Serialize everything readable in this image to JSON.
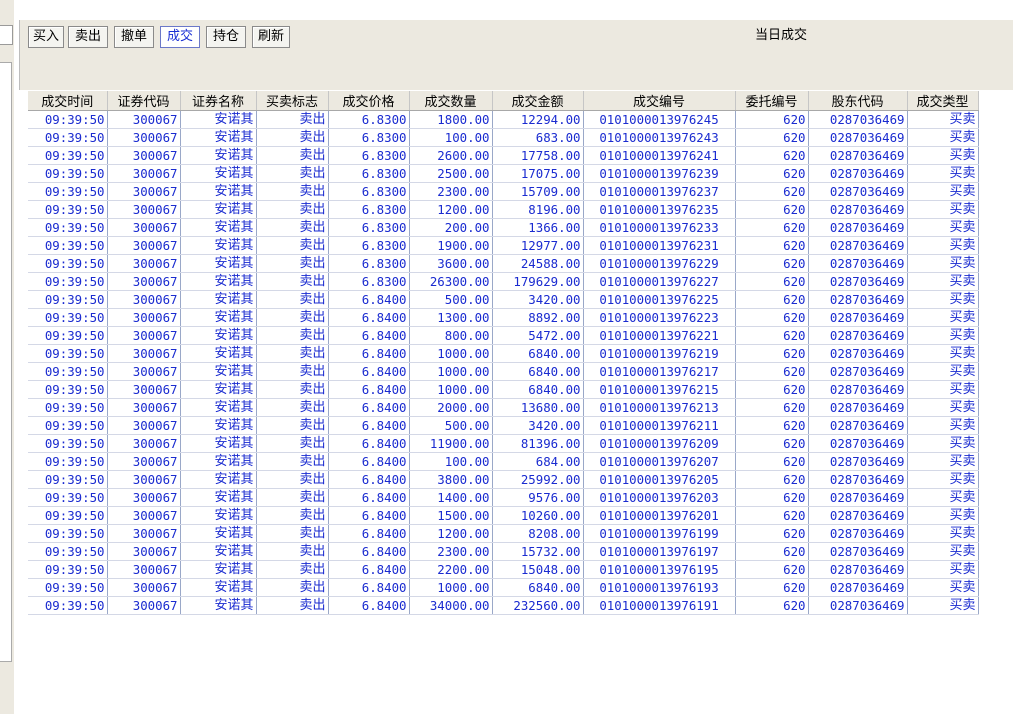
{
  "toolbar": {
    "buttons": [
      "买入",
      "卖出",
      "撤单",
      "成交",
      "持仓",
      "刷新"
    ],
    "active": "成交",
    "title": "当日成交"
  },
  "table": {
    "columns": [
      "成交时间",
      "证券代码",
      "证券名称",
      "买卖标志",
      "成交价格",
      "成交数量",
      "成交金额",
      "成交编号",
      "委托编号",
      "股东代码",
      "成交类型"
    ],
    "rows": [
      [
        "09:39:50",
        "300067",
        "安诺其",
        "卖出",
        "6.8300",
        "1800.00",
        "12294.00",
        "0101000013976245",
        "620",
        "0287036469",
        "买卖"
      ],
      [
        "09:39:50",
        "300067",
        "安诺其",
        "卖出",
        "6.8300",
        "100.00",
        "683.00",
        "0101000013976243",
        "620",
        "0287036469",
        "买卖"
      ],
      [
        "09:39:50",
        "300067",
        "安诺其",
        "卖出",
        "6.8300",
        "2600.00",
        "17758.00",
        "0101000013976241",
        "620",
        "0287036469",
        "买卖"
      ],
      [
        "09:39:50",
        "300067",
        "安诺其",
        "卖出",
        "6.8300",
        "2500.00",
        "17075.00",
        "0101000013976239",
        "620",
        "0287036469",
        "买卖"
      ],
      [
        "09:39:50",
        "300067",
        "安诺其",
        "卖出",
        "6.8300",
        "2300.00",
        "15709.00",
        "0101000013976237",
        "620",
        "0287036469",
        "买卖"
      ],
      [
        "09:39:50",
        "300067",
        "安诺其",
        "卖出",
        "6.8300",
        "1200.00",
        "8196.00",
        "0101000013976235",
        "620",
        "0287036469",
        "买卖"
      ],
      [
        "09:39:50",
        "300067",
        "安诺其",
        "卖出",
        "6.8300",
        "200.00",
        "1366.00",
        "0101000013976233",
        "620",
        "0287036469",
        "买卖"
      ],
      [
        "09:39:50",
        "300067",
        "安诺其",
        "卖出",
        "6.8300",
        "1900.00",
        "12977.00",
        "0101000013976231",
        "620",
        "0287036469",
        "买卖"
      ],
      [
        "09:39:50",
        "300067",
        "安诺其",
        "卖出",
        "6.8300",
        "3600.00",
        "24588.00",
        "0101000013976229",
        "620",
        "0287036469",
        "买卖"
      ],
      [
        "09:39:50",
        "300067",
        "安诺其",
        "卖出",
        "6.8300",
        "26300.00",
        "179629.00",
        "0101000013976227",
        "620",
        "0287036469",
        "买卖"
      ],
      [
        "09:39:50",
        "300067",
        "安诺其",
        "卖出",
        "6.8400",
        "500.00",
        "3420.00",
        "0101000013976225",
        "620",
        "0287036469",
        "买卖"
      ],
      [
        "09:39:50",
        "300067",
        "安诺其",
        "卖出",
        "6.8400",
        "1300.00",
        "8892.00",
        "0101000013976223",
        "620",
        "0287036469",
        "买卖"
      ],
      [
        "09:39:50",
        "300067",
        "安诺其",
        "卖出",
        "6.8400",
        "800.00",
        "5472.00",
        "0101000013976221",
        "620",
        "0287036469",
        "买卖"
      ],
      [
        "09:39:50",
        "300067",
        "安诺其",
        "卖出",
        "6.8400",
        "1000.00",
        "6840.00",
        "0101000013976219",
        "620",
        "0287036469",
        "买卖"
      ],
      [
        "09:39:50",
        "300067",
        "安诺其",
        "卖出",
        "6.8400",
        "1000.00",
        "6840.00",
        "0101000013976217",
        "620",
        "0287036469",
        "买卖"
      ],
      [
        "09:39:50",
        "300067",
        "安诺其",
        "卖出",
        "6.8400",
        "1000.00",
        "6840.00",
        "0101000013976215",
        "620",
        "0287036469",
        "买卖"
      ],
      [
        "09:39:50",
        "300067",
        "安诺其",
        "卖出",
        "6.8400",
        "2000.00",
        "13680.00",
        "0101000013976213",
        "620",
        "0287036469",
        "买卖"
      ],
      [
        "09:39:50",
        "300067",
        "安诺其",
        "卖出",
        "6.8400",
        "500.00",
        "3420.00",
        "0101000013976211",
        "620",
        "0287036469",
        "买卖"
      ],
      [
        "09:39:50",
        "300067",
        "安诺其",
        "卖出",
        "6.8400",
        "11900.00",
        "81396.00",
        "0101000013976209",
        "620",
        "0287036469",
        "买卖"
      ],
      [
        "09:39:50",
        "300067",
        "安诺其",
        "卖出",
        "6.8400",
        "100.00",
        "684.00",
        "0101000013976207",
        "620",
        "0287036469",
        "买卖"
      ],
      [
        "09:39:50",
        "300067",
        "安诺其",
        "卖出",
        "6.8400",
        "3800.00",
        "25992.00",
        "0101000013976205",
        "620",
        "0287036469",
        "买卖"
      ],
      [
        "09:39:50",
        "300067",
        "安诺其",
        "卖出",
        "6.8400",
        "1400.00",
        "9576.00",
        "0101000013976203",
        "620",
        "0287036469",
        "买卖"
      ],
      [
        "09:39:50",
        "300067",
        "安诺其",
        "卖出",
        "6.8400",
        "1500.00",
        "10260.00",
        "0101000013976201",
        "620",
        "0287036469",
        "买卖"
      ],
      [
        "09:39:50",
        "300067",
        "安诺其",
        "卖出",
        "6.8400",
        "1200.00",
        "8208.00",
        "0101000013976199",
        "620",
        "0287036469",
        "买卖"
      ],
      [
        "09:39:50",
        "300067",
        "安诺其",
        "卖出",
        "6.8400",
        "2300.00",
        "15732.00",
        "0101000013976197",
        "620",
        "0287036469",
        "买卖"
      ],
      [
        "09:39:50",
        "300067",
        "安诺其",
        "卖出",
        "6.8400",
        "2200.00",
        "15048.00",
        "0101000013976195",
        "620",
        "0287036469",
        "买卖"
      ],
      [
        "09:39:50",
        "300067",
        "安诺其",
        "卖出",
        "6.8400",
        "1000.00",
        "6840.00",
        "0101000013976193",
        "620",
        "0287036469",
        "买卖"
      ],
      [
        "09:39:50",
        "300067",
        "安诺其",
        "卖出",
        "6.8400",
        "34000.00",
        "232560.00",
        "0101000013976191",
        "620",
        "0287036469",
        "买卖"
      ]
    ]
  },
  "colors": {
    "cell_text": "#1a2bd0",
    "active_button_text": "#1a2fd4",
    "header_bg": "#ece9e0"
  }
}
